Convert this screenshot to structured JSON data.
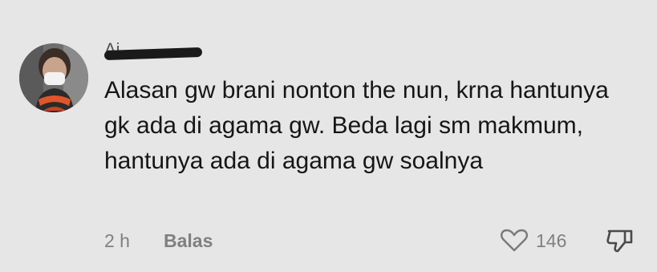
{
  "comment": {
    "username": "Ai…",
    "text": "Alasan gw brani nonton the nun, krna hantunya gk ada di agama gw. Beda lagi sm makmum, hantunya ada di agama gw soalnya",
    "time": "2 h",
    "reply_label": "Balas",
    "like_count": "146",
    "icons": {
      "like": "heart-icon",
      "dislike": "thumbs-down-icon"
    },
    "colors": {
      "background": "#e6e6e6",
      "text": "#161616",
      "meta": "#808080"
    }
  }
}
